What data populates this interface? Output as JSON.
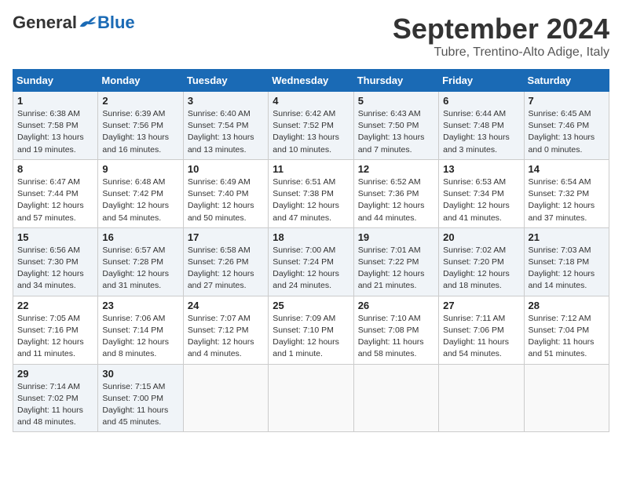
{
  "header": {
    "logo_general": "General",
    "logo_blue": "Blue",
    "month_title": "September 2024",
    "location": "Tubre, Trentino-Alto Adige, Italy"
  },
  "weekdays": [
    "Sunday",
    "Monday",
    "Tuesday",
    "Wednesday",
    "Thursday",
    "Friday",
    "Saturday"
  ],
  "weeks": [
    [
      {
        "day": "1",
        "sunrise": "6:38 AM",
        "sunset": "7:58 PM",
        "daylight": "13 hours and 19 minutes."
      },
      {
        "day": "2",
        "sunrise": "6:39 AM",
        "sunset": "7:56 PM",
        "daylight": "13 hours and 16 minutes."
      },
      {
        "day": "3",
        "sunrise": "6:40 AM",
        "sunset": "7:54 PM",
        "daylight": "13 hours and 13 minutes."
      },
      {
        "day": "4",
        "sunrise": "6:42 AM",
        "sunset": "7:52 PM",
        "daylight": "13 hours and 10 minutes."
      },
      {
        "day": "5",
        "sunrise": "6:43 AM",
        "sunset": "7:50 PM",
        "daylight": "13 hours and 7 minutes."
      },
      {
        "day": "6",
        "sunrise": "6:44 AM",
        "sunset": "7:48 PM",
        "daylight": "13 hours and 3 minutes."
      },
      {
        "day": "7",
        "sunrise": "6:45 AM",
        "sunset": "7:46 PM",
        "daylight": "13 hours and 0 minutes."
      }
    ],
    [
      {
        "day": "8",
        "sunrise": "6:47 AM",
        "sunset": "7:44 PM",
        "daylight": "12 hours and 57 minutes."
      },
      {
        "day": "9",
        "sunrise": "6:48 AM",
        "sunset": "7:42 PM",
        "daylight": "12 hours and 54 minutes."
      },
      {
        "day": "10",
        "sunrise": "6:49 AM",
        "sunset": "7:40 PM",
        "daylight": "12 hours and 50 minutes."
      },
      {
        "day": "11",
        "sunrise": "6:51 AM",
        "sunset": "7:38 PM",
        "daylight": "12 hours and 47 minutes."
      },
      {
        "day": "12",
        "sunrise": "6:52 AM",
        "sunset": "7:36 PM",
        "daylight": "12 hours and 44 minutes."
      },
      {
        "day": "13",
        "sunrise": "6:53 AM",
        "sunset": "7:34 PM",
        "daylight": "12 hours and 41 minutes."
      },
      {
        "day": "14",
        "sunrise": "6:54 AM",
        "sunset": "7:32 PM",
        "daylight": "12 hours and 37 minutes."
      }
    ],
    [
      {
        "day": "15",
        "sunrise": "6:56 AM",
        "sunset": "7:30 PM",
        "daylight": "12 hours and 34 minutes."
      },
      {
        "day": "16",
        "sunrise": "6:57 AM",
        "sunset": "7:28 PM",
        "daylight": "12 hours and 31 minutes."
      },
      {
        "day": "17",
        "sunrise": "6:58 AM",
        "sunset": "7:26 PM",
        "daylight": "12 hours and 27 minutes."
      },
      {
        "day": "18",
        "sunrise": "7:00 AM",
        "sunset": "7:24 PM",
        "daylight": "12 hours and 24 minutes."
      },
      {
        "day": "19",
        "sunrise": "7:01 AM",
        "sunset": "7:22 PM",
        "daylight": "12 hours and 21 minutes."
      },
      {
        "day": "20",
        "sunrise": "7:02 AM",
        "sunset": "7:20 PM",
        "daylight": "12 hours and 18 minutes."
      },
      {
        "day": "21",
        "sunrise": "7:03 AM",
        "sunset": "7:18 PM",
        "daylight": "12 hours and 14 minutes."
      }
    ],
    [
      {
        "day": "22",
        "sunrise": "7:05 AM",
        "sunset": "7:16 PM",
        "daylight": "12 hours and 11 minutes."
      },
      {
        "day": "23",
        "sunrise": "7:06 AM",
        "sunset": "7:14 PM",
        "daylight": "12 hours and 8 minutes."
      },
      {
        "day": "24",
        "sunrise": "7:07 AM",
        "sunset": "7:12 PM",
        "daylight": "12 hours and 4 minutes."
      },
      {
        "day": "25",
        "sunrise": "7:09 AM",
        "sunset": "7:10 PM",
        "daylight": "12 hours and 1 minute."
      },
      {
        "day": "26",
        "sunrise": "7:10 AM",
        "sunset": "7:08 PM",
        "daylight": "11 hours and 58 minutes."
      },
      {
        "day": "27",
        "sunrise": "7:11 AM",
        "sunset": "7:06 PM",
        "daylight": "11 hours and 54 minutes."
      },
      {
        "day": "28",
        "sunrise": "7:12 AM",
        "sunset": "7:04 PM",
        "daylight": "11 hours and 51 minutes."
      }
    ],
    [
      {
        "day": "29",
        "sunrise": "7:14 AM",
        "sunset": "7:02 PM",
        "daylight": "11 hours and 48 minutes."
      },
      {
        "day": "30",
        "sunrise": "7:15 AM",
        "sunset": "7:00 PM",
        "daylight": "11 hours and 45 minutes."
      },
      null,
      null,
      null,
      null,
      null
    ]
  ]
}
